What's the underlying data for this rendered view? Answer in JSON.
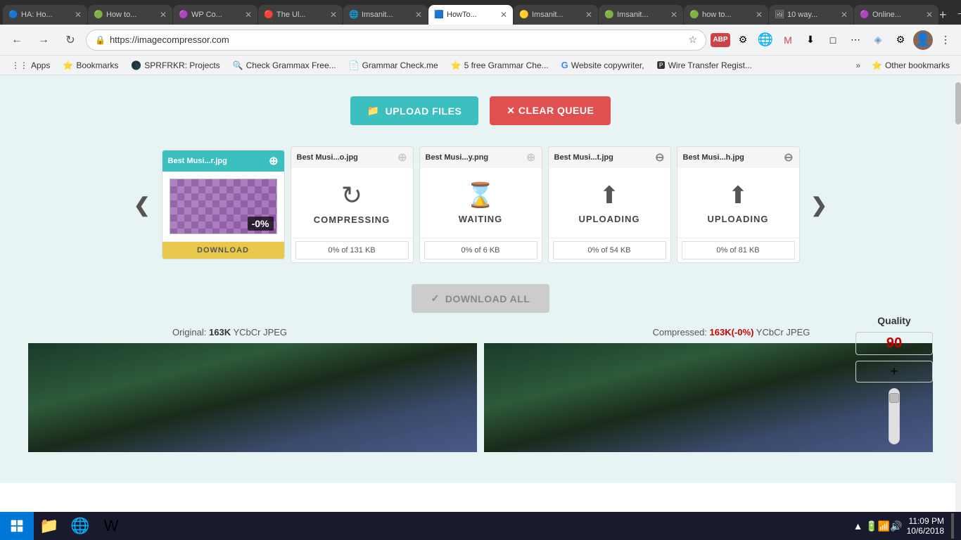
{
  "browser": {
    "address": "https://imagecompressor.com",
    "tabs": [
      {
        "id": "t1",
        "title": "HA: Ho...",
        "favicon": "🔵",
        "active": false
      },
      {
        "id": "t2",
        "title": "How to...",
        "favicon": "🟢",
        "active": false
      },
      {
        "id": "t3",
        "title": "WP Co...",
        "favicon": "🟣",
        "active": false
      },
      {
        "id": "t4",
        "title": "The Ul...",
        "favicon": "🔴",
        "active": false
      },
      {
        "id": "t5",
        "title": "Imsanit...",
        "favicon": "🌐",
        "active": false
      },
      {
        "id": "t6",
        "title": "HowTo...",
        "favicon": "🟦",
        "active": true
      },
      {
        "id": "t7",
        "title": "Imsanit...",
        "favicon": "🟡",
        "active": false
      },
      {
        "id": "t8",
        "title": "Imsanit...",
        "favicon": "🟢",
        "active": false
      },
      {
        "id": "t9",
        "title": "how to...",
        "favicon": "🟢",
        "active": false
      },
      {
        "id": "t10",
        "title": "10 way...",
        "favicon": "🖼",
        "active": false
      },
      {
        "id": "t11",
        "title": "Online...",
        "favicon": "🟣",
        "active": false
      }
    ]
  },
  "bookmarks": [
    {
      "label": "Apps",
      "icon": "⋮⋮"
    },
    {
      "label": "Bookmarks",
      "icon": "⭐"
    },
    {
      "label": "SPRFRKR: Projects",
      "icon": "🌑"
    },
    {
      "label": "Check Grammax Free...",
      "icon": "🔍"
    },
    {
      "label": "Grammar Check.me",
      "icon": "📄"
    },
    {
      "label": "5 free Grammar Che...",
      "icon": "⭐"
    },
    {
      "label": "Website copywriter,",
      "icon": "G"
    },
    {
      "label": "Wire Transfer Regist...",
      "icon": "🅿"
    }
  ],
  "page": {
    "upload_btn": "UPLOAD FILES",
    "clear_btn": "✕  CLEAR QUEUE",
    "download_all_btn": "DOWNLOAD ALL",
    "nav_prev": "❮",
    "nav_next": "❯",
    "files": [
      {
        "name": "Best Musi...r.jpg",
        "status": "done",
        "active": true,
        "progress": null,
        "download_btn": "DOWNLOAD"
      },
      {
        "name": "Best Musi...o.jpg",
        "status": "COMPRESSING",
        "active": false,
        "progress": "0% of 131 KB",
        "icon": "↻"
      },
      {
        "name": "Best Musi...y.png",
        "status": "WAITING",
        "active": false,
        "progress": "0% of 6 KB",
        "icon": "⌛"
      },
      {
        "name": "Best Musi...t.jpg",
        "status": "UPLOADING",
        "active": false,
        "progress": "0% of 54 KB",
        "icon": "↑"
      },
      {
        "name": "Best Musi...h.jpg",
        "status": "UPLOADING",
        "active": false,
        "progress": "0% of 81 KB",
        "icon": "↑"
      }
    ],
    "original_label": "Original:",
    "original_size": "163K",
    "original_format": "YCbCr JPEG",
    "compressed_label": "Compressed:",
    "compressed_size": "163K(-0%)",
    "compressed_format": "YCbCr JPEG",
    "quality_label": "Quality",
    "quality_value": "90",
    "quality_plus": "+"
  },
  "taskbar": {
    "time": "11:09 PM",
    "date": "10/6/2018",
    "start_icon": "⊞"
  }
}
